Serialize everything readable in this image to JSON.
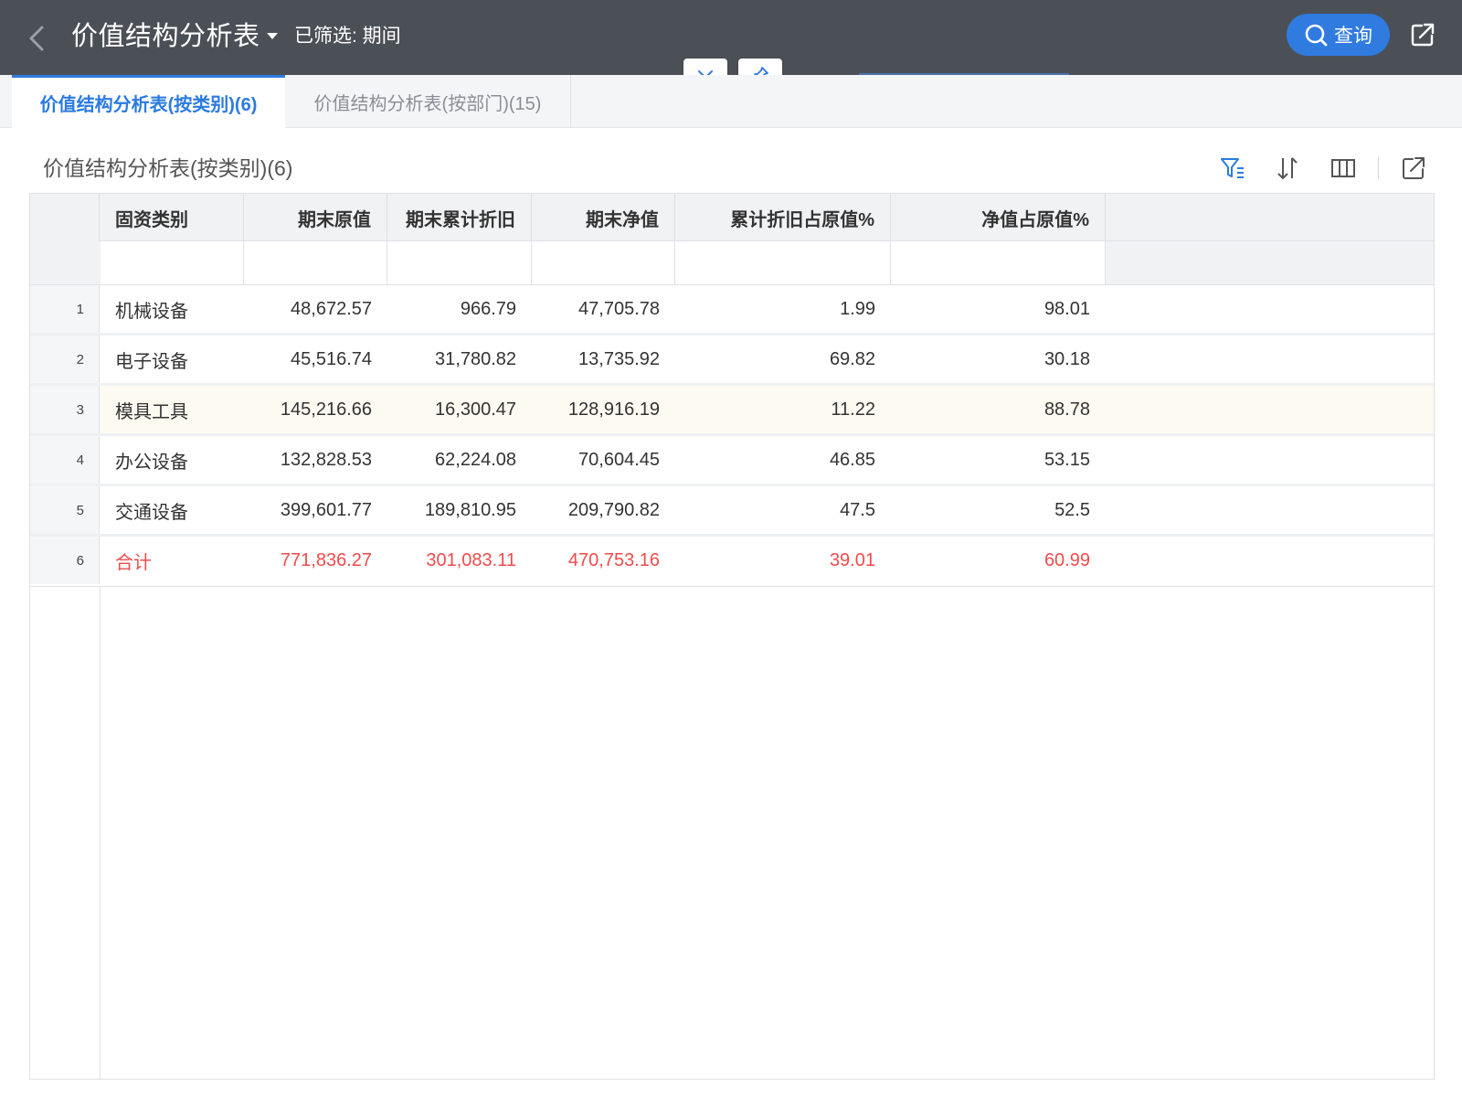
{
  "header": {
    "title": "价值结构分析表",
    "filter_note": "已筛选: 期间",
    "query_label": "查询"
  },
  "tabs": [
    {
      "label": "价值结构分析表(按类别)(6)",
      "active": true
    },
    {
      "label": "价值结构分析表(按部门)(15)",
      "active": false
    }
  ],
  "section": {
    "title": "价值结构分析表(按类别)(6)"
  },
  "icons": {
    "back": "chevron-left-icon",
    "title_dropdown": "caret-down-icon",
    "query": "search-icon",
    "export": "export-icon",
    "collapse": "chevron-down-icon",
    "pin": "pin-icon",
    "filter": "filter-icon",
    "sort": "sort-icon",
    "columns": "columns-icon"
  },
  "colors": {
    "header_bg": "#4b5057",
    "accent": "#2b7be0",
    "total_text": "#ef4b4b",
    "highlight_row": "#fdfaf1"
  },
  "table": {
    "columns": [
      "固资类别",
      "期末原值",
      "期末累计折旧",
      "期末净值",
      "累计折旧占原值%",
      "净值占原值%"
    ],
    "rows": [
      {
        "num": "1",
        "cells": [
          "机械设备",
          "48,672.57",
          "966.79",
          "47,705.78",
          "1.99",
          "98.01"
        ]
      },
      {
        "num": "2",
        "cells": [
          "电子设备",
          "45,516.74",
          "31,780.82",
          "13,735.92",
          "69.82",
          "30.18"
        ]
      },
      {
        "num": "3",
        "cells": [
          "模具工具",
          "145,216.66",
          "16,300.47",
          "128,916.19",
          "11.22",
          "88.78"
        ]
      },
      {
        "num": "4",
        "cells": [
          "办公设备",
          "132,828.53",
          "62,224.08",
          "70,604.45",
          "46.85",
          "53.15"
        ]
      },
      {
        "num": "5",
        "cells": [
          "交通设备",
          "399,601.77",
          "189,810.95",
          "209,790.82",
          "47.5",
          "52.5"
        ]
      },
      {
        "num": "6",
        "cells": [
          "合计",
          "771,836.27",
          "301,083.11",
          "470,753.16",
          "39.01",
          "60.99"
        ]
      }
    ]
  }
}
